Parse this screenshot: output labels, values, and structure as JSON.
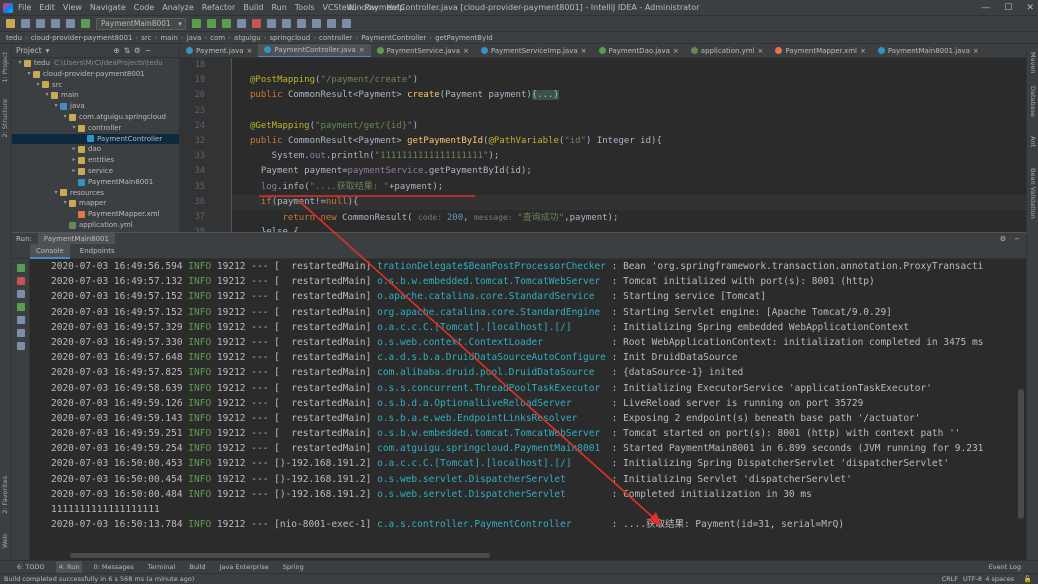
{
  "window": {
    "menu": [
      "File",
      "Edit",
      "View",
      "Navigate",
      "Code",
      "Analyze",
      "Refactor",
      "Build",
      "Run",
      "Tools",
      "VCS",
      "Window",
      "Help"
    ],
    "title": "tedu - PaymentController.java [cloud-provider-payment8001] - IntelliJ IDEA - Administrator",
    "minimize": "—",
    "maximize": "☐",
    "close": "✕"
  },
  "toolbar": {
    "run_config": "PaymentMain8001"
  },
  "breadcrumb": [
    "tedu",
    "cloud-provider-payment8001",
    "src",
    "main",
    "java",
    "com",
    "atguigu",
    "springcloud",
    "controller",
    "PaymentController",
    "getPaymentById"
  ],
  "left_strip": [
    "1: Project",
    "2: Structure",
    "2: Favorites",
    "Web"
  ],
  "right_strip": [
    "Maven",
    "Database",
    "Ant",
    "Bean Validation"
  ],
  "project": {
    "header": "Project",
    "tree": [
      {
        "label": "tedu",
        "extra": "C:\\Users\\MrC\\IdeaProjects\\tedu",
        "indent": 0,
        "arrow": "▾",
        "color": "#c9a954"
      },
      {
        "label": "cloud-provider-payment8001",
        "indent": 1,
        "arrow": "▾",
        "color": "#c9a954"
      },
      {
        "label": "src",
        "indent": 2,
        "arrow": "▾",
        "color": "#c9a954"
      },
      {
        "label": "main",
        "indent": 3,
        "arrow": "▾",
        "color": "#c9a954"
      },
      {
        "label": "java",
        "indent": 4,
        "arrow": "▾",
        "color": "#4a88c7"
      },
      {
        "label": "com.atguigu.springcloud",
        "indent": 5,
        "arrow": "▾",
        "color": "#c9a954"
      },
      {
        "label": "controller",
        "indent": 6,
        "arrow": "▾",
        "color": "#c9a954"
      },
      {
        "label": "PaymentController",
        "indent": 7,
        "arrow": "",
        "color": "#3592c4",
        "selected": true
      },
      {
        "label": "dao",
        "indent": 6,
        "arrow": "▸",
        "color": "#c9a954"
      },
      {
        "label": "entities",
        "indent": 6,
        "arrow": "▸",
        "color": "#c9a954"
      },
      {
        "label": "service",
        "indent": 6,
        "arrow": "▸",
        "color": "#c9a954"
      },
      {
        "label": "PaymentMain8001",
        "indent": 6,
        "arrow": "",
        "color": "#3592c4"
      },
      {
        "label": "resources",
        "indent": 4,
        "arrow": "▾",
        "color": "#c9a954"
      },
      {
        "label": "mapper",
        "indent": 5,
        "arrow": "▾",
        "color": "#c9a954"
      },
      {
        "label": "PaymentMapper.xml",
        "indent": 6,
        "arrow": "",
        "color": "#e8754a"
      },
      {
        "label": "application.yml",
        "indent": 5,
        "arrow": "",
        "color": "#6a8759"
      }
    ]
  },
  "editor_tabs": [
    {
      "label": "Payment.java",
      "color": "#3592c4"
    },
    {
      "label": "PaymentController.java",
      "color": "#3592c4",
      "active": true
    },
    {
      "label": "PaymentService.java",
      "color": "#5a9e4d"
    },
    {
      "label": "PaymentServiceImp.java",
      "color": "#3592c4"
    },
    {
      "label": "PaymentDao.java",
      "color": "#5a9e4d"
    },
    {
      "label": "application.yml",
      "color": "#6a8759"
    },
    {
      "label": "PaymentMapper.xml",
      "color": "#e8754a"
    },
    {
      "label": "PaymentMain8001.java",
      "color": "#3592c4"
    }
  ],
  "gutter": [
    "18",
    "19",
    "20",
    "23",
    "24",
    "32",
    "33",
    "34",
    "35",
    "36",
    "37",
    "38"
  ],
  "code": [
    {
      "t": [
        [
          "",
          ""
        ]
      ]
    },
    {
      "t": [
        [
          "an",
          "@PostMapping"
        ],
        [
          "",
          "("
        ],
        [
          "st",
          "\"/payment/create\""
        ],
        [
          "",
          ")"
        ]
      ]
    },
    {
      "t": [
        [
          "kw",
          "public "
        ],
        [
          "",
          "CommonResult<Payment> "
        ],
        [
          "fn",
          "create"
        ],
        [
          "",
          "(Payment payment)"
        ],
        [
          "fold",
          "{...}"
        ]
      ]
    },
    {
      "t": [
        [
          "",
          ""
        ]
      ]
    },
    {
      "t": [
        [
          "an",
          "@GetMapping"
        ],
        [
          "",
          "("
        ],
        [
          "st",
          "\"payment/get/{id}\""
        ],
        [
          "",
          ")"
        ]
      ]
    },
    {
      "t": [
        [
          "kw",
          "public "
        ],
        [
          "",
          "CommonResult<Payment> "
        ],
        [
          "fn",
          "getPaymentById"
        ],
        [
          "",
          "("
        ],
        [
          "an",
          "@PathVariable"
        ],
        [
          "",
          "("
        ],
        [
          "st",
          "\"id\""
        ],
        [
          "",
          ") Integer id){"
        ]
      ]
    },
    {
      "t": [
        [
          "",
          "    System."
        ],
        [
          "fld",
          "out"
        ],
        [
          "",
          ".println("
        ],
        [
          "st",
          "\"1111111111111111111\""
        ],
        [
          "",
          ");"
        ]
      ]
    },
    {
      "t": [
        [
          "",
          "  Payment payment="
        ],
        [
          "fld",
          "paymentService"
        ],
        [
          "",
          ".getPaymentById(id);"
        ]
      ]
    },
    {
      "t": [
        [
          "",
          "  "
        ],
        [
          "fld",
          "log"
        ],
        [
          "",
          ".info("
        ],
        [
          "st",
          "\"....获取结果: \""
        ],
        [
          "",
          "+payment);"
        ]
      ]
    },
    {
      "t": [
        [
          "",
          "  "
        ],
        [
          "kw",
          "if"
        ],
        [
          "",
          "(payment!="
        ],
        [
          "kw",
          "null"
        ],
        [
          "",
          "){"
        ]
      ],
      "cur": true
    },
    {
      "t": [
        [
          "",
          "      "
        ],
        [
          "kw",
          "return new "
        ],
        [
          "",
          "CommonResult( "
        ],
        [
          "hint",
          "code: "
        ],
        [
          "nm",
          "200"
        ],
        [
          "",
          ", "
        ],
        [
          "hint",
          "message: "
        ],
        [
          "st",
          "\"查询成功\""
        ],
        [
          "",
          ",payment);"
        ]
      ]
    },
    {
      "t": [
        [
          "",
          "  }else {"
        ]
      ]
    }
  ],
  "run": {
    "label": "Run:",
    "config": "PaymentMain8001",
    "tabs": [
      "Console",
      "Endpoints"
    ]
  },
  "console": [
    {
      "ts": "2020-07-03 16:49:56.594",
      "lv": "INFO",
      "pid": "19212",
      "thr": "[  restartedMain]",
      "lgr": "trationDelegate$BeanPostProcessorChecker",
      "msg": ": Bean 'org.springframework.transaction.annotation.ProxyTransacti"
    },
    {
      "ts": "2020-07-03 16:49:57.132",
      "lv": "INFO",
      "pid": "19212",
      "thr": "[  restartedMain]",
      "lgr": "o.s.b.w.embedded.tomcat.TomcatWebServer ",
      "msg": ": Tomcat initialized with port(s): 8001 (http)"
    },
    {
      "ts": "2020-07-03 16:49:57.152",
      "lv": "INFO",
      "pid": "19212",
      "thr": "[  restartedMain]",
      "lgr": "o.apache.catalina.core.StandardService  ",
      "msg": ": Starting service [Tomcat]"
    },
    {
      "ts": "2020-07-03 16:49:57.152",
      "lv": "INFO",
      "pid": "19212",
      "thr": "[  restartedMain]",
      "lgr": "org.apache.catalina.core.StandardEngine ",
      "msg": ": Starting Servlet engine: [Apache Tomcat/9.0.29]"
    },
    {
      "ts": "2020-07-03 16:49:57.329",
      "lv": "INFO",
      "pid": "19212",
      "thr": "[  restartedMain]",
      "lgr": "o.a.c.c.C.[Tomcat].[localhost].[/]      ",
      "msg": ": Initializing Spring embedded WebApplicationContext"
    },
    {
      "ts": "2020-07-03 16:49:57.330",
      "lv": "INFO",
      "pid": "19212",
      "thr": "[  restartedMain]",
      "lgr": "o.s.web.context.ContextLoader           ",
      "msg": ": Root WebApplicationContext: initialization completed in 3475 ms"
    },
    {
      "ts": "2020-07-03 16:49:57.648",
      "lv": "INFO",
      "pid": "19212",
      "thr": "[  restartedMain]",
      "lgr": "c.a.d.s.b.a.DruidDataSourceAutoConfigure",
      "msg": ": Init DruidDataSource"
    },
    {
      "ts": "2020-07-03 16:49:57.825",
      "lv": "INFO",
      "pid": "19212",
      "thr": "[  restartedMain]",
      "lgr": "com.alibaba.druid.pool.DruidDataSource  ",
      "msg": ": {dataSource-1} inited"
    },
    {
      "ts": "2020-07-03 16:49:58.639",
      "lv": "INFO",
      "pid": "19212",
      "thr": "[  restartedMain]",
      "lgr": "o.s.s.concurrent.ThreadPoolTaskExecutor ",
      "msg": ": Initializing ExecutorService 'applicationTaskExecutor'"
    },
    {
      "ts": "2020-07-03 16:49:59.126",
      "lv": "INFO",
      "pid": "19212",
      "thr": "[  restartedMain]",
      "lgr": "o.s.b.d.a.OptionalLiveReloadServer      ",
      "msg": ": LiveReload server is running on port 35729"
    },
    {
      "ts": "2020-07-03 16:49:59.143",
      "lv": "INFO",
      "pid": "19212",
      "thr": "[  restartedMain]",
      "lgr": "o.s.b.a.e.web.EndpointLinksResolver     ",
      "msg": ": Exposing 2 endpoint(s) beneath base path '/actuator'"
    },
    {
      "ts": "2020-07-03 16:49:59.251",
      "lv": "INFO",
      "pid": "19212",
      "thr": "[  restartedMain]",
      "lgr": "o.s.b.w.embedded.tomcat.TomcatWebServer ",
      "msg": ": Tomcat started on port(s): 8001 (http) with context path ''"
    },
    {
      "ts": "2020-07-03 16:49:59.254",
      "lv": "INFO",
      "pid": "19212",
      "thr": "[  restartedMain]",
      "lgr": "com.atguigu.springcloud.PaymentMain8001 ",
      "msg": ": Started PaymentMain8001 in 6.899 seconds (JVM running for 9.231"
    },
    {
      "ts": "2020-07-03 16:50:00.453",
      "lv": "INFO",
      "pid": "19212",
      "thr": "[)-192.168.191.2]",
      "lgr": "o.a.c.c.C.[Tomcat].[localhost].[/]      ",
      "msg": ": Initializing Spring DispatcherServlet 'dispatcherServlet'"
    },
    {
      "ts": "2020-07-03 16:50:00.454",
      "lv": "INFO",
      "pid": "19212",
      "thr": "[)-192.168.191.2]",
      "lgr": "o.s.web.servlet.DispatcherServlet       ",
      "msg": ": Initializing Servlet 'dispatcherServlet'"
    },
    {
      "ts": "2020-07-03 16:50:00.484",
      "lv": "INFO",
      "pid": "19212",
      "thr": "[)-192.168.191.2]",
      "lgr": "o.s.web.servlet.DispatcherServlet       ",
      "msg": ": Completed initialization in 30 ms"
    },
    {
      "plain": "1111111111111111111"
    },
    {
      "ts": "2020-07-03 16:50:13.784",
      "lv": "INFO",
      "pid": "19212",
      "thr": "[nio-8001-exec-1]",
      "lgr": "c.a.s.controller.PaymentController      ",
      "msg": ": ....获取结果: Payment(id=31, serial=MrQ)"
    }
  ],
  "bottom_tabs": [
    "6: TODO",
    "4: Run",
    "0: Messages",
    "Terminal",
    "Build",
    "Java Enterprise",
    "Spring"
  ],
  "event_log": "Event Log",
  "status": {
    "message": "Build completed successfully in 6 s 568 ms (a minute ago)",
    "right": [
      "CRLF",
      "UTF-8",
      "4 spaces"
    ]
  },
  "colors": {
    "accent": "#4a88c7",
    "annotation_arrow": "#e0302a"
  }
}
